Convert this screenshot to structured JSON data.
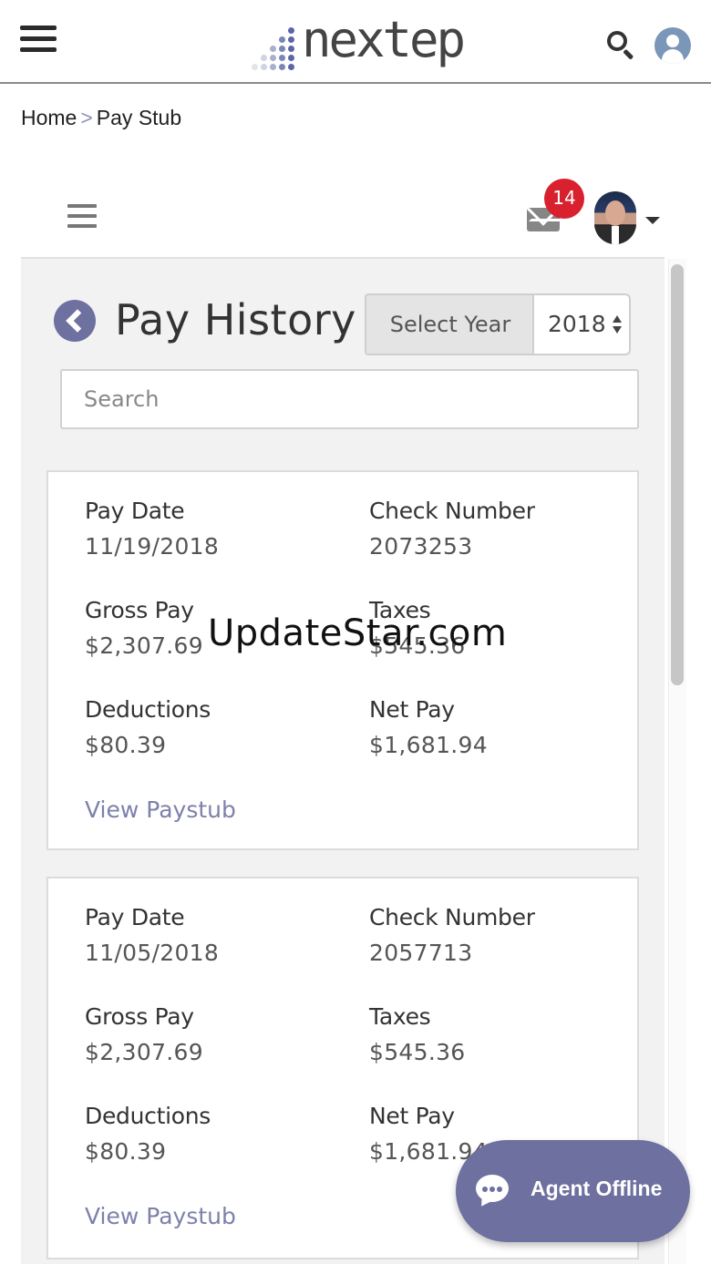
{
  "header": {
    "brand": "nextep",
    "brand_dot_colors": [
      "#ffffff",
      "#ffffff",
      "#ffffff",
      "#ffffff",
      "#5b66a8",
      "#ffffff",
      "#ffffff",
      "#ffffff",
      "#7b86b8",
      "#5b66a8",
      "#ffffff",
      "#ffffff",
      "#aab0cc",
      "#7b86b8",
      "#5b66a8",
      "#ffffff",
      "#d0d3e0",
      "#aab0cc",
      "#7b86b8",
      "#5b66a8",
      "#e2e4ec",
      "#d0d3e0",
      "#aab0cc",
      "#7b86b8",
      "#5b66a8"
    ]
  },
  "breadcrumb": {
    "home": "Home",
    "separator": ">",
    "current": "Pay Stub"
  },
  "app_bar": {
    "unread_count": "14"
  },
  "page": {
    "title": "Pay History",
    "year_label": "Select Year",
    "year_value": "2018",
    "search_placeholder": "Search"
  },
  "labels": {
    "pay_date": "Pay Date",
    "check_number": "Check Number",
    "gross_pay": "Gross Pay",
    "taxes": "Taxes",
    "deductions": "Deductions",
    "net_pay": "Net Pay",
    "view_paystub": "View Paystub"
  },
  "paystubs": [
    {
      "pay_date": "11/19/2018",
      "check_number": "2073253",
      "gross_pay": "$2,307.69",
      "taxes": "$545.36",
      "deductions": "$80.39",
      "net_pay": "$1,681.94"
    },
    {
      "pay_date": "11/05/2018",
      "check_number": "2057713",
      "gross_pay": "$2,307.69",
      "taxes": "$545.36",
      "deductions": "$80.39",
      "net_pay": "$1,681.94"
    }
  ],
  "chat": {
    "label": "Agent Offline"
  },
  "watermark": "UpdateStar.com",
  "colors": {
    "accent": "#6e70a0",
    "badge": "#d8202e",
    "link": "#7d81aa"
  }
}
